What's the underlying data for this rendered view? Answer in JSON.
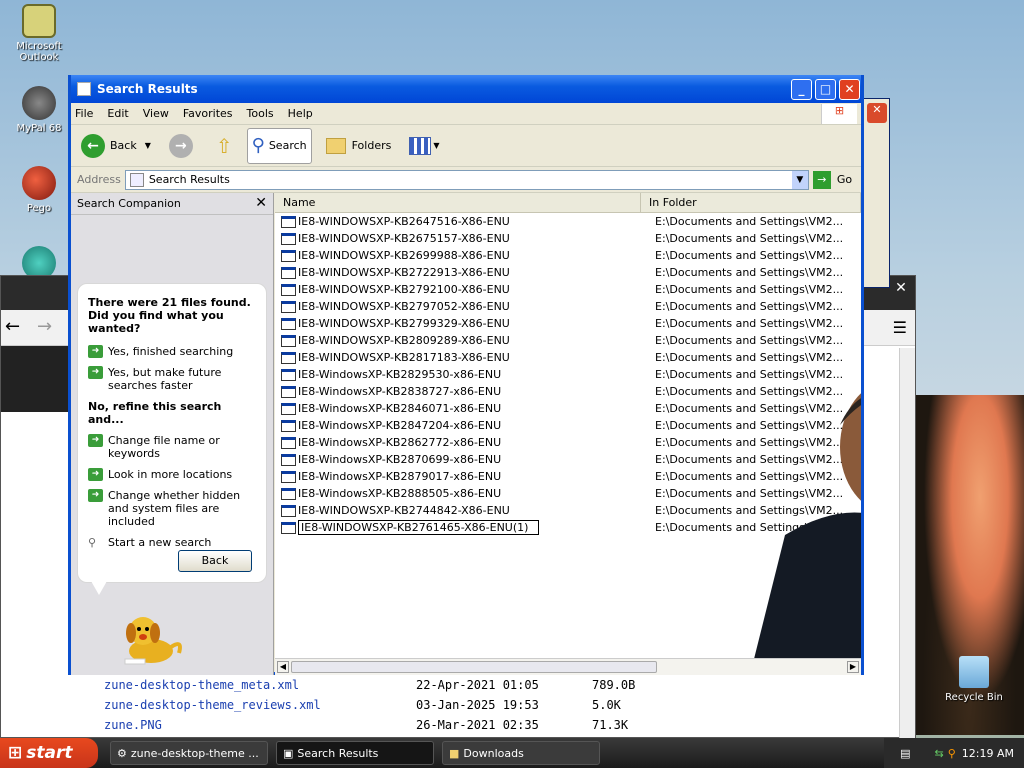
{
  "desktop": {
    "icons": [
      {
        "label": "Microsoft Outlook"
      },
      {
        "label": "MyPal 68"
      },
      {
        "label": "Pego"
      },
      {
        "label": "Recycle Bin"
      }
    ]
  },
  "window": {
    "title": "Search Results",
    "menu": [
      "File",
      "Edit",
      "View",
      "Favorites",
      "Tools",
      "Help"
    ],
    "toolbar": {
      "back": "Back",
      "search": "Search",
      "folders": "Folders"
    },
    "address": {
      "label": "Address",
      "value": "Search Results",
      "go": "Go"
    },
    "companion": {
      "title": "Search Companion",
      "question": "There were 21 files found. Did you find what you wanted?",
      "opt1": "Yes, finished searching",
      "opt2": "Yes, but make future searches faster",
      "refine": "No, refine this search and...",
      "opt3": "Change file name or keywords",
      "opt4": "Look in more locations",
      "opt5": "Change whether hidden and system files are included",
      "opt6": "Start a new search",
      "back": "Back"
    },
    "columns": {
      "name": "Name",
      "folder": "In Folder"
    },
    "files": [
      {
        "name": "IE8-WINDOWSXP-KB2647516-X86-ENU",
        "folder": "E:\\Documents and Settings\\VM2..."
      },
      {
        "name": "IE8-WINDOWSXP-KB2675157-X86-ENU",
        "folder": "E:\\Documents and Settings\\VM2..."
      },
      {
        "name": "IE8-WINDOWSXP-KB2699988-X86-ENU",
        "folder": "E:\\Documents and Settings\\VM2..."
      },
      {
        "name": "IE8-WINDOWSXP-KB2722913-X86-ENU",
        "folder": "E:\\Documents and Settings\\VM2..."
      },
      {
        "name": "IE8-WINDOWSXP-KB2792100-X86-ENU",
        "folder": "E:\\Documents and Settings\\VM2..."
      },
      {
        "name": "IE8-WINDOWSXP-KB2797052-X86-ENU",
        "folder": "E:\\Documents and Settings\\VM2..."
      },
      {
        "name": "IE8-WINDOWSXP-KB2799329-X86-ENU",
        "folder": "E:\\Documents and Settings\\VM2..."
      },
      {
        "name": "IE8-WINDOWSXP-KB2809289-X86-ENU",
        "folder": "E:\\Documents and Settings\\VM2..."
      },
      {
        "name": "IE8-WINDOWSXP-KB2817183-X86-ENU",
        "folder": "E:\\Documents and Settings\\VM2..."
      },
      {
        "name": "IE8-WindowsXP-KB2829530-x86-ENU",
        "folder": "E:\\Documents and Settings\\VM2..."
      },
      {
        "name": "IE8-WindowsXP-KB2838727-x86-ENU",
        "folder": "E:\\Documents and Settings\\VM2..."
      },
      {
        "name": "IE8-WindowsXP-KB2846071-x86-ENU",
        "folder": "E:\\Documents and Settings\\VM2..."
      },
      {
        "name": "IE8-WindowsXP-KB2847204-x86-ENU",
        "folder": "E:\\Documents and Settings\\VM2..."
      },
      {
        "name": "IE8-WindowsXP-KB2862772-x86-ENU",
        "folder": "E:\\Documents and Settings\\VM2..."
      },
      {
        "name": "IE8-WindowsXP-KB2870699-x86-ENU",
        "folder": "E:\\Documents and Settings\\VM2..."
      },
      {
        "name": "IE8-WindowsXP-KB2879017-x86-ENU",
        "folder": "E:\\Documents and Settings\\VM2..."
      },
      {
        "name": "IE8-WindowsXP-KB2888505-x86-ENU",
        "folder": "E:\\Documents and Settings\\VM2..."
      },
      {
        "name": "IE8-WINDOWSXP-KB2744842-X86-ENU",
        "folder": "E:\\Documents and Settings\\VM2..."
      },
      {
        "name": "IE8-WINDOWSXP-KB2761465-X86-ENU(1)",
        "folder": "E:\\Documents and Settings\\VM2..."
      }
    ]
  },
  "browser": {
    "downloads": [
      {
        "name": "zune-desktop-theme_meta.xml",
        "date": "22-Apr-2021 01:05",
        "size": "789.0B"
      },
      {
        "name": "zune-desktop-theme_reviews.xml",
        "date": "03-Jan-2025 19:53",
        "size": "5.0K"
      },
      {
        "name": "zune.PNG",
        "date": "26-Mar-2021 02:35",
        "size": "71.3K"
      }
    ]
  },
  "taskbar": {
    "start": "start",
    "tasks": [
      "zune-desktop-theme ...",
      "Search Results",
      "Downloads"
    ],
    "clock": "12:19 AM"
  }
}
